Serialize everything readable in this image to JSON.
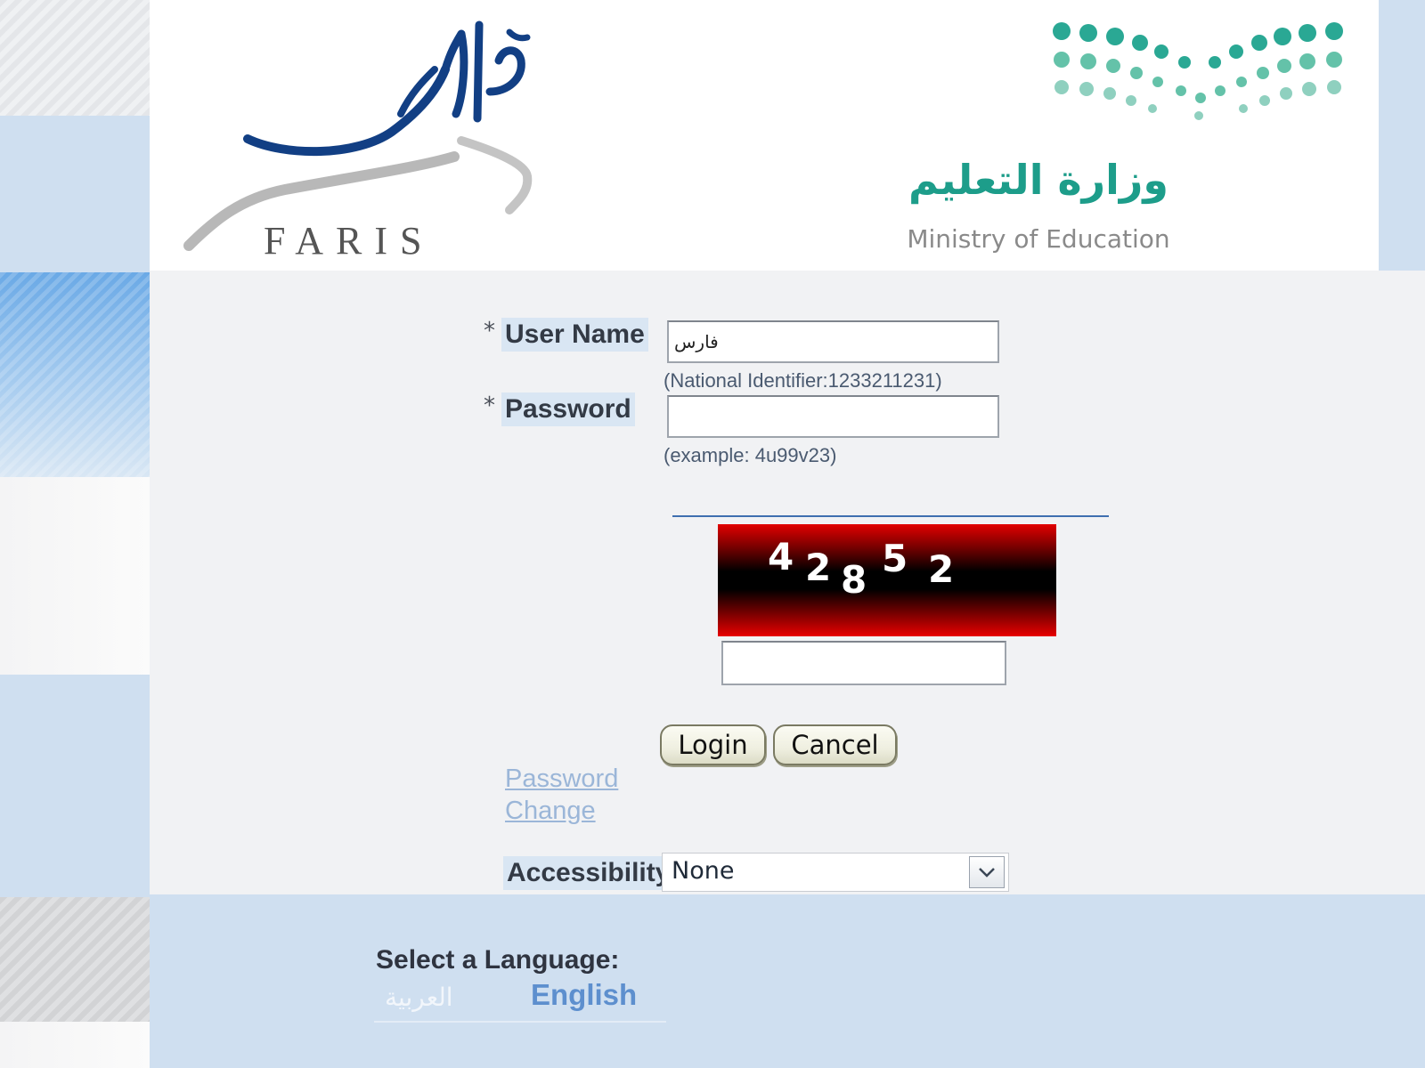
{
  "header": {
    "faris_logo_text": "FARIS",
    "faris_logo_arabic": "فارس",
    "ministry_arabic": "وزارة التعليم",
    "ministry_english": "Ministry of Education"
  },
  "form": {
    "required_marker": "*",
    "username": {
      "label": "User Name",
      "value": "فارس",
      "hint": "(National Identifier:1233211231)"
    },
    "password": {
      "label": "Password",
      "value": "",
      "hint": "(example: 4u99v23)"
    },
    "captcha": {
      "digits": [
        "4",
        "2",
        "8",
        "5",
        "2"
      ],
      "input_value": ""
    },
    "buttons": {
      "login": "Login",
      "cancel": "Cancel"
    },
    "password_change_link": "Password Change",
    "accessibility": {
      "label": "Accessibility",
      "selected": "None"
    }
  },
  "footer": {
    "select_language_label": "Select a Language:",
    "languages": [
      "العربية",
      "English"
    ]
  },
  "colors": {
    "label_background": "#d9e6f3",
    "footer_background": "#cfdff0",
    "link_color": "#9bb6d8",
    "english_link": "#5d8fce",
    "faris_blue": "#123f84",
    "ministry_teal": "#1d9d8a"
  },
  "icons": {
    "accessibility_dropdown": "chevron-down-icon"
  }
}
